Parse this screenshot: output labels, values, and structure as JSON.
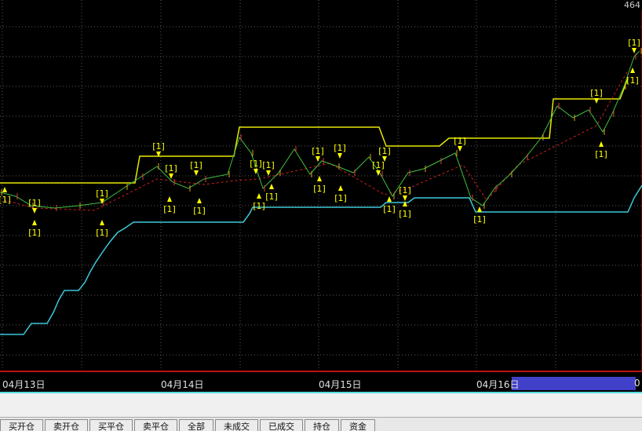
{
  "price_label": "464",
  "right_edge_label": "0",
  "dates": [
    "04月13日",
    "04月14日",
    "04月15日",
    "04月16日"
  ],
  "signal_label": "[1]",
  "tabs": [
    "买开仓",
    "卖开仓",
    "买平仓",
    "卖平仓",
    "全部",
    "未成交",
    "已成交",
    "持仓",
    "资金"
  ],
  "colors": {
    "background": "#000000",
    "upper_channel": "#e8e800",
    "lower_channel": "#3ec8d8",
    "trend_dashed": "#d02020",
    "signal": "#ffff00",
    "separator": "#c01010",
    "date_highlight": "#4040c8"
  }
}
